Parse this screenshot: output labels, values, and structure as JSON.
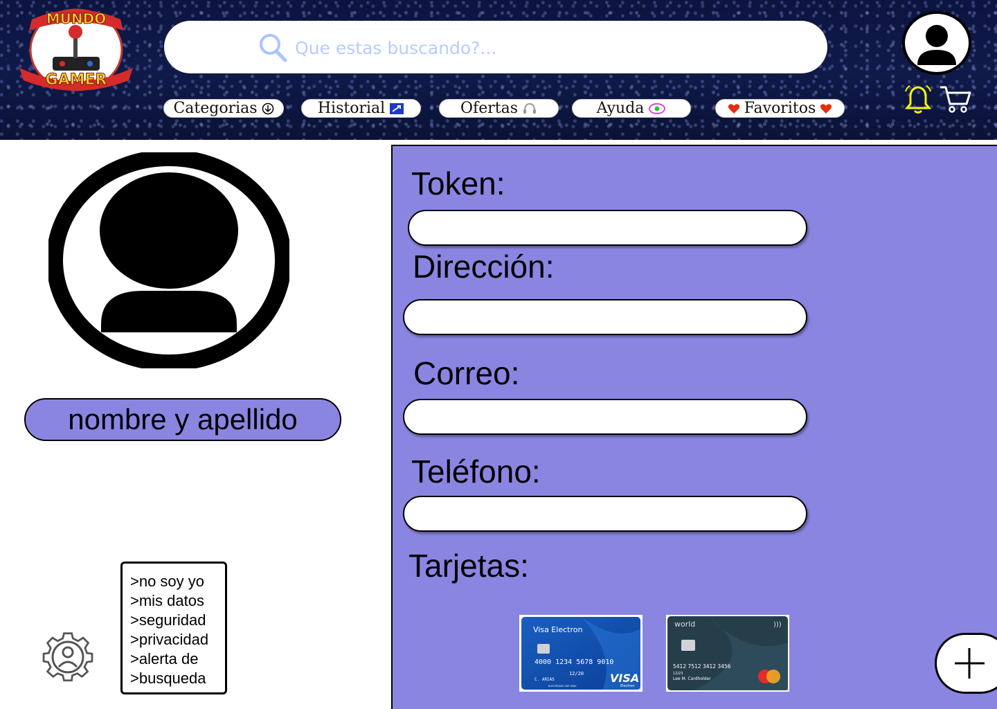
{
  "header": {
    "logo_top_text": "MUNDO",
    "logo_bottom_text": "GAMER",
    "search_placeholder": "Que estas buscando?...",
    "nav": [
      {
        "label": "Categorias",
        "icon": "arrow-down-circle-icon"
      },
      {
        "label": "Historial",
        "icon": "history-icon"
      },
      {
        "label": "Ofertas",
        "icon": "headset-icon"
      },
      {
        "label": "Ayuda",
        "icon": "help-eye-icon"
      },
      {
        "label": "Favoritos",
        "icon": "heart-icon"
      }
    ],
    "colors": {
      "bell": "#f5f500",
      "cart": "#ffffff"
    }
  },
  "profile": {
    "name_placeholder": "nombre y apellido",
    "menu": [
      ">no soy yo",
      ">mis datos",
      ">seguridad",
      ">privacidad",
      ">alerta de",
      ">busqueda"
    ]
  },
  "form": {
    "token_label": "Token:",
    "direccion_label": "Dirección:",
    "correo_label": "Correo:",
    "telefono_label": "Teléfono:",
    "tarjetas_label": "Tarjetas:"
  },
  "cards": [
    {
      "brand_label": "Visa Electron",
      "number": "4000  1234  5678  9010",
      "expiry": "12/20",
      "holder": "C. ARIAS",
      "network": "VISA",
      "network_sub": "Electron",
      "footer": "ELECTRONIC USE ONLY"
    },
    {
      "brand_label": "world",
      "number": "5412 7512 3412 3456",
      "expiry": "12/23",
      "holder": "Lee M. Cardholder",
      "network": "mastercard"
    }
  ],
  "theme": {
    "panel": "#8b85e2",
    "header": "#0c1440"
  }
}
